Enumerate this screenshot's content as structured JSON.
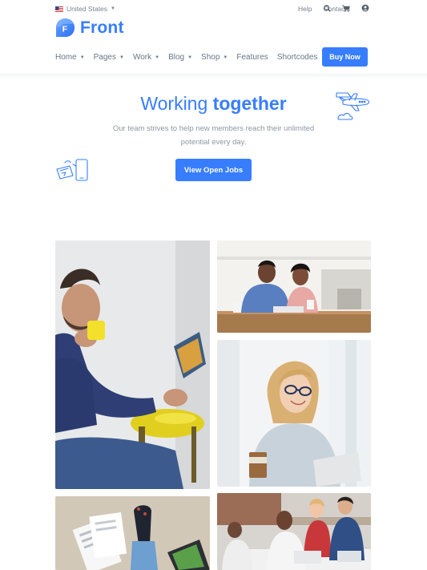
{
  "topbar": {
    "region_label": "United States",
    "links": [
      "Help",
      "Contacts"
    ],
    "icons": [
      "search-icon",
      "cart-icon",
      "user-icon"
    ]
  },
  "logo": {
    "mark_letter": "F",
    "text": "Front"
  },
  "nav": {
    "items": [
      {
        "label": "Home",
        "has_dropdown": true
      },
      {
        "label": "Pages",
        "has_dropdown": true
      },
      {
        "label": "Work",
        "has_dropdown": true
      },
      {
        "label": "Blog",
        "has_dropdown": true
      },
      {
        "label": "Shop",
        "has_dropdown": true
      },
      {
        "label": "Features",
        "has_dropdown": false
      },
      {
        "label": "Shortcodes",
        "has_dropdown": false
      }
    ],
    "cta": "Buy Now"
  },
  "hero": {
    "title_regular": "Working ",
    "title_bold": "together",
    "subtitle": "Our team strives to help new members reach their unlimited potential every day.",
    "cta": "View Open Jobs"
  },
  "gallery": {
    "photos": [
      {
        "name": "man-reading-photo"
      },
      {
        "name": "couple-laptop-photo"
      },
      {
        "name": "woman-laptop-photo"
      },
      {
        "name": "floor-documents-photo"
      },
      {
        "name": "team-meeting-photo"
      }
    ]
  },
  "colors": {
    "primary": "#377dff",
    "text_muted": "#77838f",
    "background": "#ffffff"
  }
}
